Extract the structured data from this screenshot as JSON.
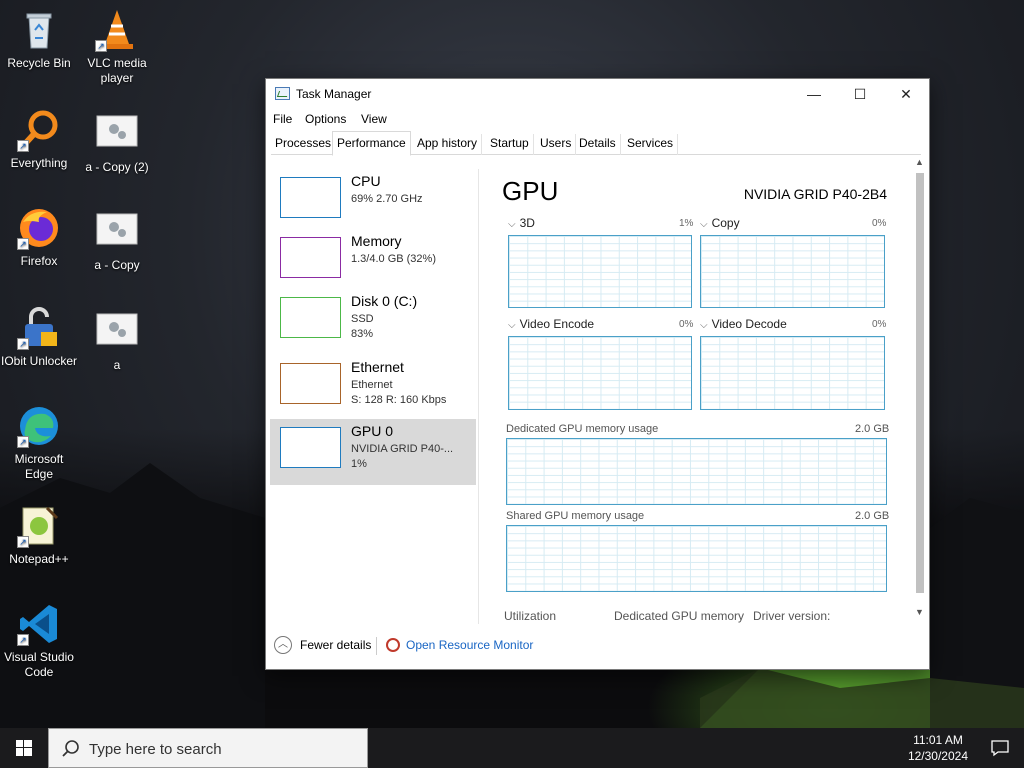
{
  "desktop": {
    "icons": [
      {
        "label": "Recycle Bin",
        "icon": "recycle-bin-icon"
      },
      {
        "label": "VLC media player",
        "icon": "vlc-icon"
      },
      {
        "label": "Everything",
        "icon": "everything-search-icon"
      },
      {
        "label": "a - Copy (2)",
        "icon": "generic-file-icon"
      },
      {
        "label": "Firefox",
        "icon": "firefox-icon"
      },
      {
        "label": "a - Copy",
        "icon": "generic-file-icon"
      },
      {
        "label": "IObit Unlocker",
        "icon": "iobit-unlocker-icon"
      },
      {
        "label": "a",
        "icon": "generic-file-icon"
      },
      {
        "label": "Microsoft Edge",
        "icon": "edge-icon"
      },
      {
        "label": "Notepad++",
        "icon": "notepad-plus-plus-icon"
      },
      {
        "label": "Visual Studio Code",
        "icon": "vscode-icon"
      }
    ]
  },
  "window": {
    "title": "Task Manager",
    "controls": {
      "minimize": "—",
      "maximize": "☐",
      "close": "✕"
    },
    "menu": [
      "File",
      "Options",
      "View"
    ],
    "tabs": [
      "Processes",
      "Performance",
      "App history",
      "Startup",
      "Users",
      "Details",
      "Services"
    ],
    "active_tab": "Performance"
  },
  "perf_list": [
    {
      "name": "CPU",
      "sub1": "69% 2.70 GHz",
      "sub2": "",
      "color": "#1f7bbf"
    },
    {
      "name": "Memory",
      "sub1": "1.3/4.0 GB (32%)",
      "sub2": "",
      "color": "#8b2ba3"
    },
    {
      "name": "Disk 0 (C:)",
      "sub1": "SSD",
      "sub2": "83%",
      "color": "#4cb848"
    },
    {
      "name": "Ethernet",
      "sub1": "Ethernet",
      "sub2": "S: 128 R: 160 Kbps",
      "color": "#a8642a"
    },
    {
      "name": "GPU 0",
      "sub1": "NVIDIA GRID P40-...",
      "sub2": "1%",
      "color": "#1f7bbf"
    }
  ],
  "gpu": {
    "title": "GPU",
    "model": "NVIDIA GRID P40-2B4",
    "engines": [
      {
        "label": "3D",
        "pct": "1%"
      },
      {
        "label": "Copy",
        "pct": "0%"
      },
      {
        "label": "Video Encode",
        "pct": "0%"
      },
      {
        "label": "Video Decode",
        "pct": "0%"
      }
    ],
    "dedicated_label": "Dedicated GPU memory usage",
    "dedicated_max": "2.0 GB",
    "shared_label": "Shared GPU memory usage",
    "shared_max": "2.0 GB",
    "stats_headers": [
      "Utilization",
      "Dedicated GPU memory",
      "Driver version:"
    ]
  },
  "footer": {
    "fewer_details": "Fewer details",
    "open_resource_monitor": "Open Resource Monitor"
  },
  "taskbar": {
    "search_placeholder": "Type here to search",
    "time": "11:01 AM",
    "date": "12/30/2024"
  },
  "colors": {
    "graph_border": "#4aa0c8",
    "link": "#1a66c4",
    "selected_item": "#d9d9d9"
  }
}
